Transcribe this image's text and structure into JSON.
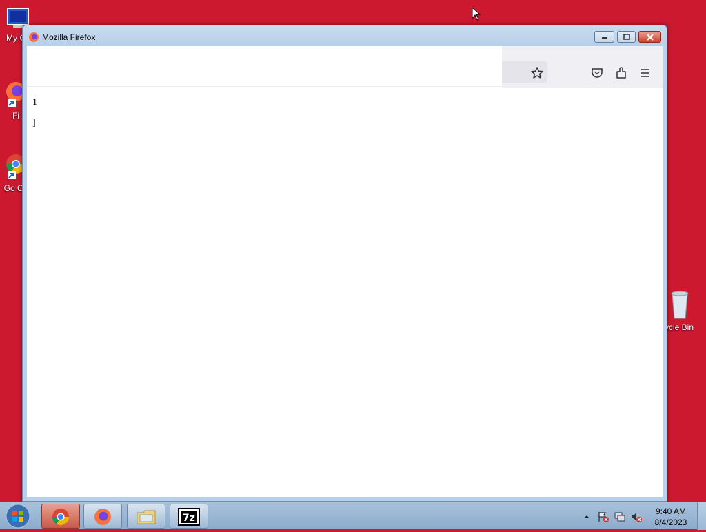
{
  "desktop": {
    "icons": [
      {
        "label": "My C"
      },
      {
        "label": "Fi"
      },
      {
        "label": "Go Ch"
      },
      {
        "label": "ycle Bin"
      }
    ]
  },
  "window": {
    "title": "Mozilla Firefox"
  },
  "page": {
    "line1": "1",
    "line2": "]"
  },
  "taskbar": {
    "time": "9:40 AM",
    "date": "8/4/2023",
    "buttons": [
      "chrome",
      "firefox",
      "file-explorer",
      "7-zip"
    ],
    "seven_zip_label": "7z"
  },
  "colors": {
    "desktop_background": "#cc1930",
    "taskbar": "#a8c2dc",
    "window_frame": "#b9d1ea"
  }
}
